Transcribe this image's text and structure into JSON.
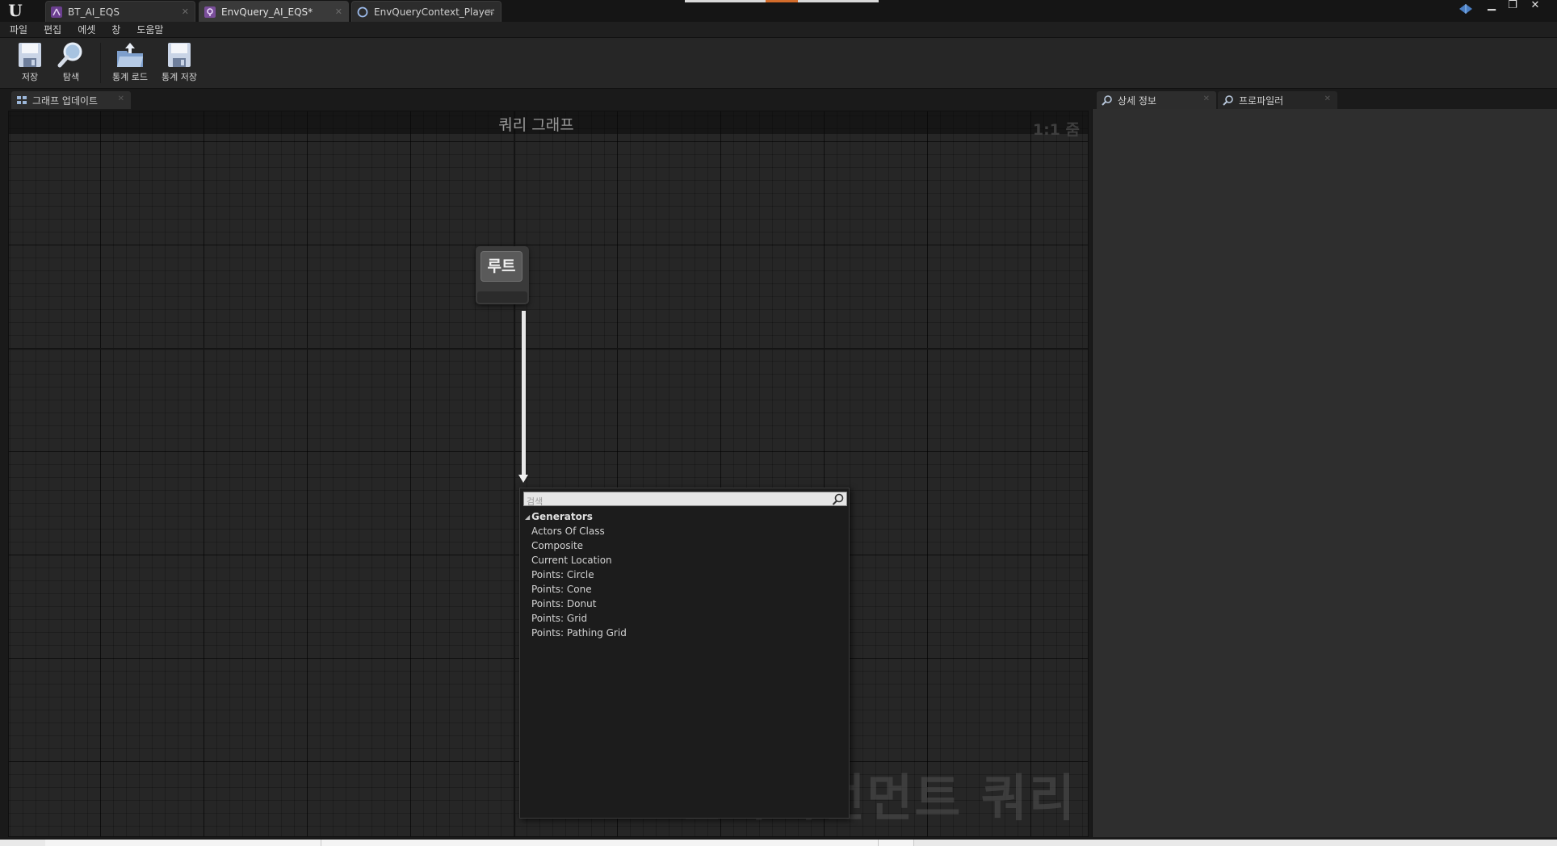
{
  "app": {
    "logo": "U"
  },
  "tabs": [
    {
      "label": "BT_AI_EQS",
      "icon": "behavior-tree-icon",
      "active": false
    },
    {
      "label": "EnvQuery_AI_EQS*",
      "icon": "env-query-icon",
      "active": true
    },
    {
      "label": "EnvQueryContext_Player",
      "icon": "context-icon",
      "active": false
    }
  ],
  "menu": [
    "파일",
    "편집",
    "에셋",
    "창",
    "도움말"
  ],
  "toolbar": {
    "save_label": "저장",
    "browse_label": "탐색",
    "load_stats_label": "통계 로드",
    "save_stats_label": "통계 저장"
  },
  "panels": {
    "graph_tab_label": "그래프 업데이트",
    "details_tab_label": "상세 정보",
    "profiler_tab_label": "프로파일러"
  },
  "graph": {
    "title": "쿼리 그래프",
    "zoom": "1:1 줌",
    "watermark": "인바이런먼트 쿼리",
    "root_label": "루트"
  },
  "context_menu": {
    "search_placeholder": "검색",
    "category": "Generators",
    "items": [
      "Actors Of Class",
      "Composite",
      "Current Location",
      "Points: Circle",
      "Points: Cone",
      "Points: Donut",
      "Points: Grid",
      "Points: Pathing Grid"
    ]
  },
  "colors": {
    "accent_orange": "#d36c2b",
    "graph_bg": "#262626",
    "panel_bg": "#2e2e2e"
  }
}
